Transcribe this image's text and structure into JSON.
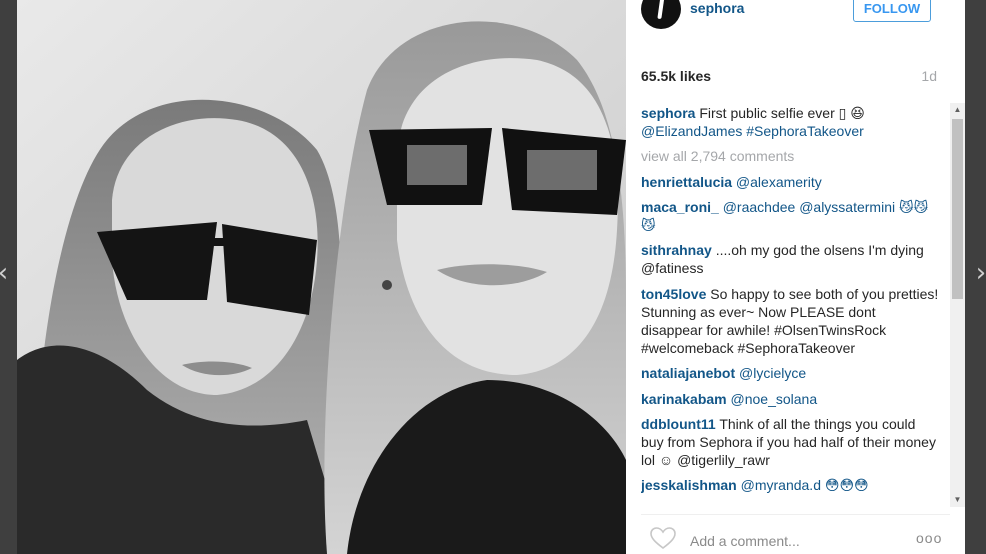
{
  "post": {
    "username": "sephora",
    "follow_label": "FOLLOW",
    "likes": "65.5k likes",
    "age": "1d"
  },
  "caption": {
    "user": "sephora",
    "text": "First public selfie ever ▯ 😆",
    "tags": "@ElizandJames #SephoraTakeover"
  },
  "view_all": "view all 2,794 comments",
  "comments": [
    {
      "user": "henriettalucia",
      "text": "@alexamerity"
    },
    {
      "user": "maca_roni_",
      "text": "@raachdee @alyssatermini 😼😼😼"
    },
    {
      "user": "sithrahnay",
      "text": "....oh my god the olsens I'm dying @fatiness"
    },
    {
      "user": "ton45love",
      "text": "So happy to see both of you pretties! Stunning as ever~ Now PLEASE dont disappear for awhile! #OlsenTwinsRock #welcomeback #SephoraTakeover"
    },
    {
      "user": "nataliajanebot",
      "text": "@lycielyce"
    },
    {
      "user": "karinakabam",
      "text": "@noe_solana"
    },
    {
      "user": "ddblount11",
      "text": "Think of all the things you could buy from Sephora if you had half of their money lol ☺ @tigerlily_rawr"
    },
    {
      "user": "jesskalishman",
      "text": "@myranda.d 😳😳😳"
    }
  ],
  "add_comment_placeholder": "Add a comment...",
  "more_options": "ooo",
  "nav": {
    "prev": "‹",
    "next": "›"
  },
  "icons": {
    "heart": "heart-icon",
    "avatar": "sephora-logo"
  }
}
